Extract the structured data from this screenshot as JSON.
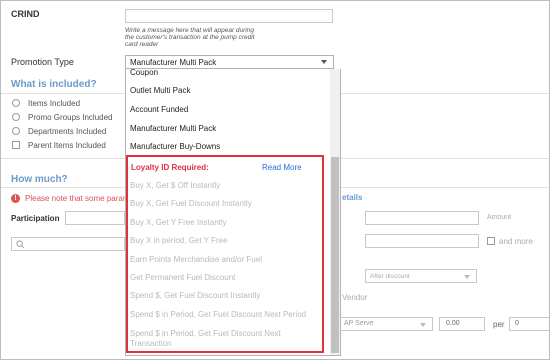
{
  "crind": {
    "label": "CRIND",
    "hint_line1": "Write a message here that will appear during",
    "hint_line2": "the customer's transaction at the pump credit",
    "hint_line3": "card reader"
  },
  "promotion_type": {
    "label": "Promotion Type",
    "selected": "Manufacturer Multi Pack",
    "options": [
      "Coupon",
      "Outlet Multi Pack",
      "Account Funded",
      "Manufacturer Multi Pack",
      "Manufacturer Buy-Downs"
    ],
    "loyalty_heading": "Loyalty ID Required:",
    "read_more": "Read More",
    "loyalty_options": [
      "Buy X, Get $ Off Instantly",
      "Buy X, Get Fuel Discount Instantly",
      "Buy X, Get Y Free Instantly",
      "Buy X in period, Get Y Free",
      "Earn Points Merchandise and/or Fuel",
      "Get Permanent Fuel Discount",
      "Spend $, Get Fuel Discount Instantly",
      "Spend $ in Period, Get Fuel Discount Next Period",
      "Spend $ in Period, Get Fuel Discount Next",
      "Transaction"
    ]
  },
  "included": {
    "title": "What is included?",
    "items": [
      "Items Included",
      "Promo Groups Included",
      "Departments Included",
      "Parent Items Included"
    ]
  },
  "how_much": {
    "title": "How much?",
    "warning": "Please note that some param",
    "details": "etails",
    "participation": "Participation",
    "amount": "Amount",
    "and_more": "and more",
    "after_discount": "After discount",
    "vendor": "Vendor",
    "ap_serve": "AP Serve",
    "value": "0.00",
    "per": "per",
    "per_value": "0"
  },
  "colors": {
    "section_title": "#6b9ac8",
    "warning": "#d9534f",
    "loyalty_border": "#e0323e",
    "read_more": "#2a6fd6"
  }
}
